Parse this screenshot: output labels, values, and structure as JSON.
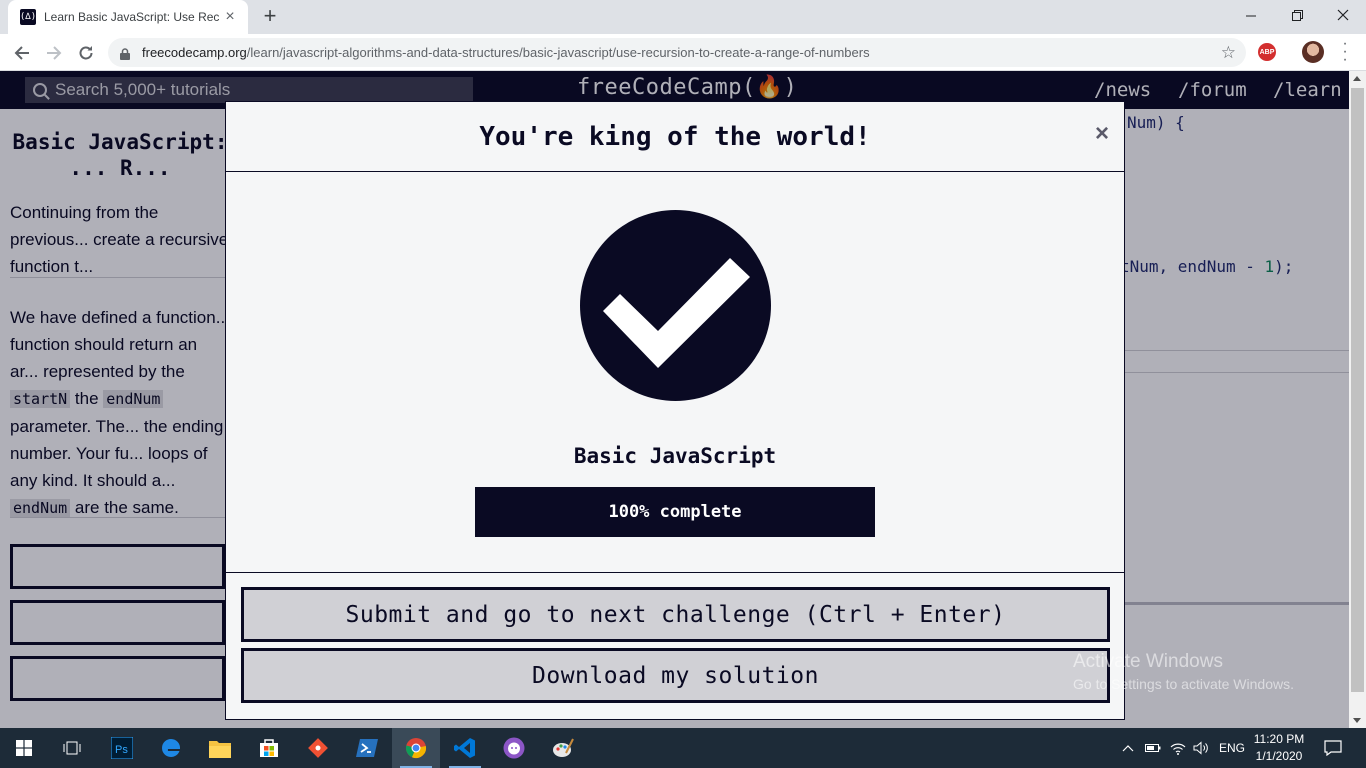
{
  "browser": {
    "tab_title": "Learn Basic JavaScript: Use Recursion to Create a Range of Numbers",
    "tab_favicon_text": "(∆)",
    "url_host": "freecodecamp.org",
    "url_path": "/learn/javascript-algorithms-and-data-structures/basic-javascript/use-recursion-to-create-a-range-of-numbers",
    "extension_badge": "ABP"
  },
  "nav": {
    "search_placeholder": "Search 5,000+ tutorials",
    "logo": "freeCodeCamp(🔥)",
    "links": [
      "/news",
      "/forum",
      "/learn"
    ]
  },
  "lesson": {
    "title": "Basic JavaScript: ... R...",
    "para1": "Continuing from the previous... create a recursive function t...",
    "para2_parts": {
      "a": "We have defined a function... function should return an ar... represented by the ",
      "code1": "startN",
      "b": " the ",
      "code2": "endNum",
      "c": " parameter. The... the ending number. Your fu... loops of any kind. It should a... ",
      "code3": "endNum",
      "d": " are the same."
    }
  },
  "editor": {
    "line1": "Num) {",
    "line2_prefix": "tNum, endNum - ",
    "line2_num": "1",
    "line2_suffix": ");"
  },
  "modal": {
    "title": "You're king of the world!",
    "close_label": "×",
    "icon": "checkmark-circle-icon",
    "certification": "Basic JavaScript",
    "progress_percent": 100,
    "progress_label": "100% complete",
    "submit_label": "Submit and go to next challenge (Ctrl + Enter)",
    "download_label": "Download my solution"
  },
  "watermark": {
    "line1": "Activate Windows",
    "line2": "Go to Settings to activate Windows."
  },
  "taskbar": {
    "apps": [
      "windows-start-icon",
      "task-view-icon",
      "photoshop-icon",
      "edge-icon",
      "file-explorer-icon",
      "store-icon",
      "git-icon",
      "powershell-icon",
      "chrome-icon",
      "vscode-icon",
      "github-desktop-icon",
      "paint-icon"
    ],
    "language": "ENG",
    "time": "11:20 PM",
    "date": "1/1/2020"
  },
  "colors": {
    "fcc_dark": "#0a0a23",
    "modal_bg": "#f5f6f7",
    "button_bg": "#d0d0d5",
    "taskbar": "#1d2b38"
  }
}
